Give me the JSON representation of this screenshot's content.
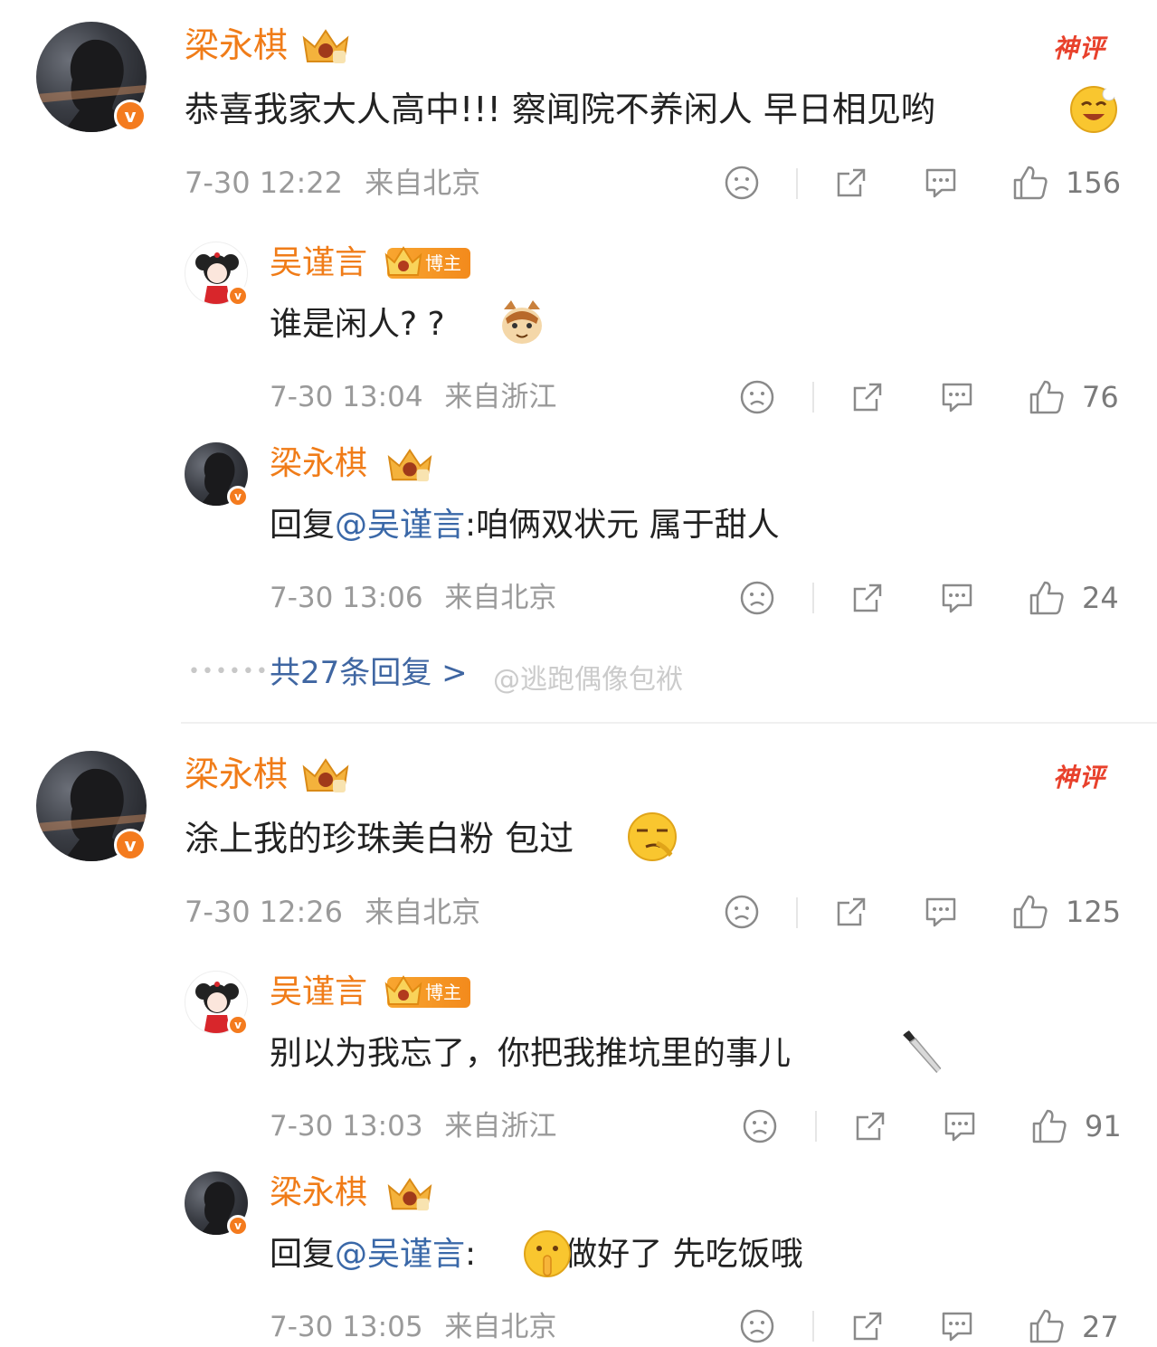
{
  "colors": {
    "username": "#f07c18",
    "mention": "#3a68a8",
    "meta": "#9a9a9a",
    "more_link": "#3f66a2",
    "hot_badge": "#e8412c"
  },
  "labels": {
    "hot": "神评",
    "blogger": "博主",
    "verified": "v"
  },
  "threads": [
    {
      "comment": {
        "user": "梁永棋",
        "text": "恭喜我家大人高中!!! 察闻院不养闲人 早日相见哟",
        "emoji": "smile-emoji",
        "time": "7-30 12:22",
        "location": "来自北京",
        "likes": "156"
      },
      "replies": [
        {
          "user": "吴谨言",
          "prefix": "",
          "mention": "",
          "text": "谁是闲人? ?",
          "emoji": "cat-emoji",
          "time": "7-30 13:04",
          "location": "来自浙江",
          "likes": "76"
        },
        {
          "user": "梁永棋",
          "prefix": "回复",
          "mention": "@吴谨言",
          "text": ":咱俩双状元 属于甜人",
          "time": "7-30 13:06",
          "location": "来自北京",
          "likes": "24"
        }
      ],
      "more_replies": "共27条回复 >"
    },
    {
      "comment": {
        "user": "梁永棋",
        "text": "涂上我的珍珠美白粉 包过",
        "emoji": "smirk-emoji",
        "time": "7-30 12:26",
        "location": "来自北京",
        "likes": "125"
      },
      "replies": [
        {
          "user": "吴谨言",
          "prefix": "",
          "mention": "",
          "text": "别以为我忘了，你把我推坑里的事儿",
          "emoji": "knife-emoji",
          "time": "7-30 13:03",
          "location": "来自浙江",
          "likes": "91"
        },
        {
          "user": "梁永棋",
          "prefix": "回复",
          "mention": "@吴谨言",
          "text": "饭做好了 先吃饭哦",
          "emoji": "shush-emoji",
          "time": "7-30 13:05",
          "location": "来自北京",
          "likes": "27"
        }
      ]
    }
  ],
  "watermark": "@逃跑偶像包袱"
}
